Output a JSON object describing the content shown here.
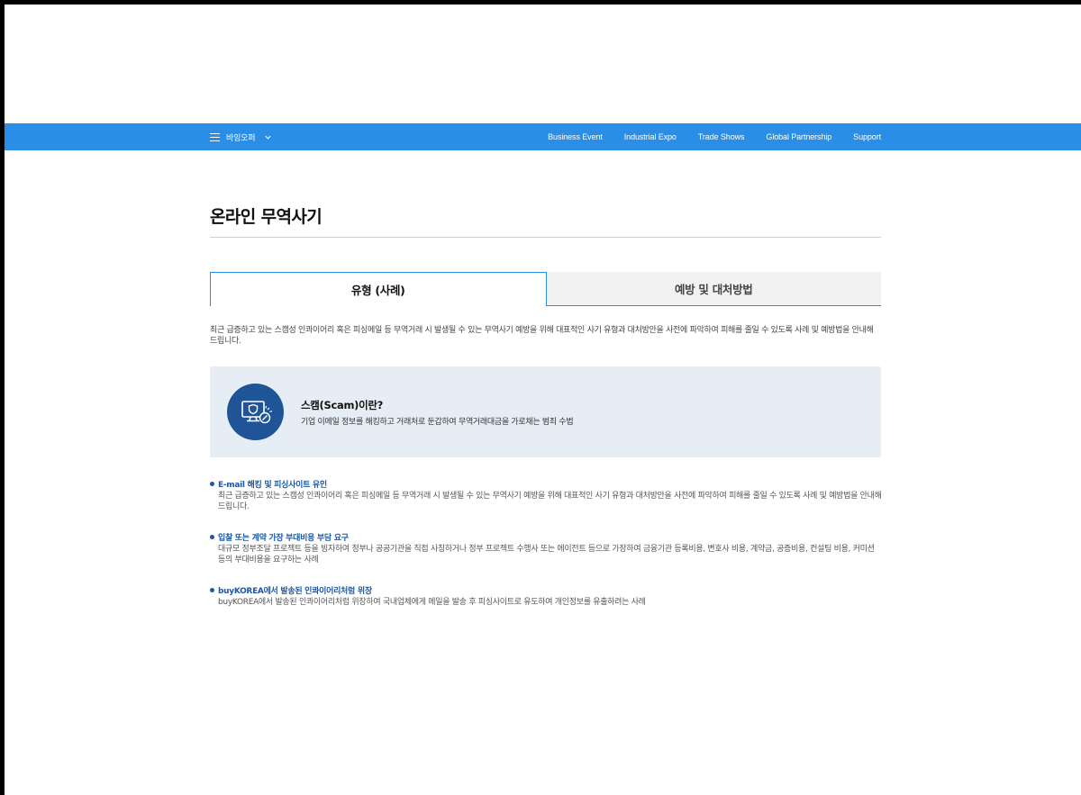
{
  "nav": {
    "menu_label": "바잉오퍼",
    "links": [
      "Business Event",
      "Industrial Expo",
      "Trade Shows",
      "Global Partnership",
      "Support"
    ]
  },
  "page": {
    "title": "온라인 무역사기"
  },
  "tabs": [
    {
      "label": "유형 (사례)",
      "active": true
    },
    {
      "label": "예방 및 대처방법",
      "active": false
    }
  ],
  "intro": "최근 급증하고 있는 스캠성 인콰이어리 혹은 피싱메일 등 무역거래 시 발생될 수 있는 무역사기 예방을 위해 대표적인 사기 유형과 대처방안을 사전에 파악하여 피해를 줄일 수 있도록 사례 및 예방법을 안내해 드립니다.",
  "scam_box": {
    "title": "스캠(Scam)이란?",
    "description": "기업 이메일 정보를 해킹하고 거래처로 둔갑하여 무역거래대금을 가로채는 범죄 수법",
    "icon": "monitor-hack-icon"
  },
  "cases": [
    {
      "title": "E-mail 해킹 및 피싱사이트 유인",
      "description": "최근 급증하고 있는 스캠성 인콰이어리 혹은 피싱메일 등 무역거래 시 발생될 수 있는 무역사기 예방을 위해 대표적인 사기 유형과 대처방안을 사전에 파악하여 피해를 줄일 수 있도록 사례 및 예방법을 안내해 드립니다."
    },
    {
      "title": "입찰 또는 계약 가장 부대비용 부담 요구",
      "description": "대규모 정부조달 프로젝트 등을 빙자하여 정부나 공공기관을 직접 사칭하거나 정부 프로젝트 수행사 또는 에이전트 등으로 가장하여 금융기관 등록비용, 변호사 비용, 계약금, 공증비용, 컨설팅 비용, 커미션 등의 부대비용을 요구하는 사례"
    },
    {
      "title": "buyKOREA에서 발송된 인콰이어리처럼 위장",
      "description": "buyKOREA에서 발송된 인콰이어리처럼 위장하여 국내업체에게 메일을 발송 후 피싱사이트로 유도하여 개인정보를 유출하려는 사례"
    }
  ],
  "colors": {
    "nav_bg": "#2b8ee6",
    "accent": "#1c58a5",
    "box_bg": "#e7edf5",
    "icon_bg": "#1f5597"
  }
}
